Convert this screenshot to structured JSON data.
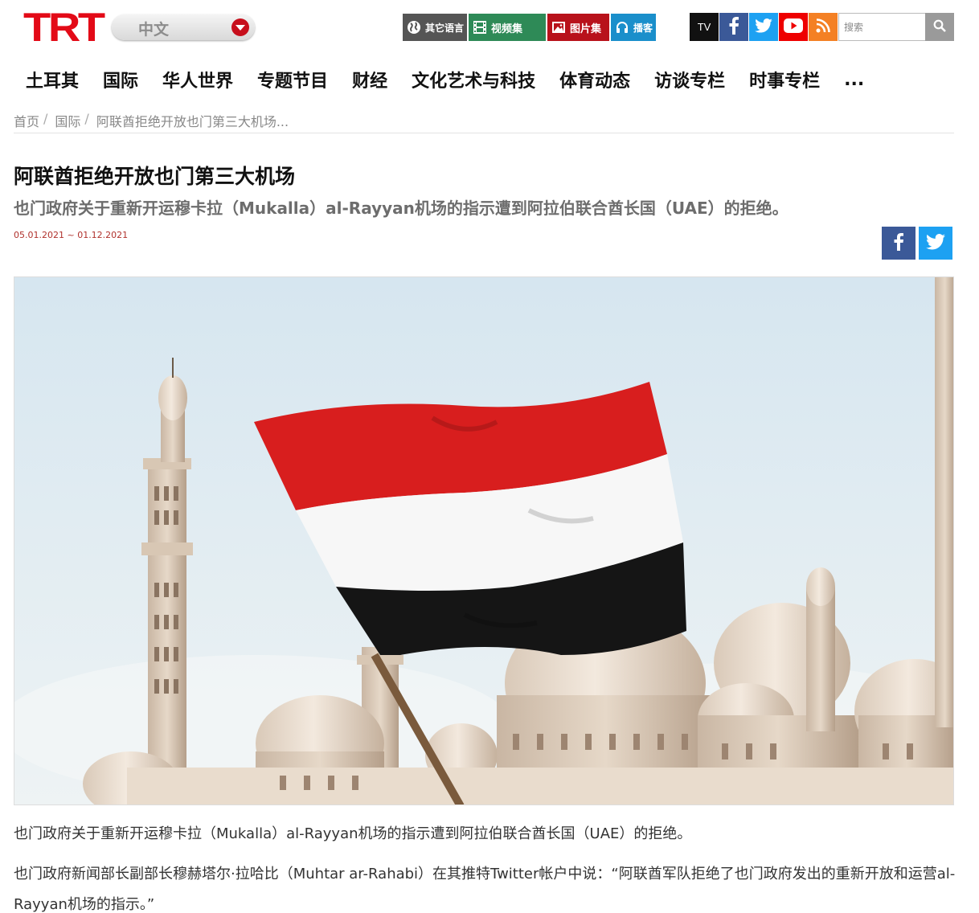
{
  "header": {
    "logo_text": "TRT",
    "language": "中文",
    "section_buttons": {
      "other_languages": "其它语言",
      "video": "视频集",
      "photo": "图片集",
      "podcast": "播客"
    },
    "social": {
      "tv": "TV"
    },
    "search_placeholder": "搜索"
  },
  "nav": {
    "items": [
      "土耳其",
      "国际",
      "华人世界",
      "专题节目",
      "财经",
      "文化艺术与科技",
      "体育动态",
      "访谈专栏",
      "时事专栏",
      "..."
    ]
  },
  "breadcrumb": {
    "items": [
      "首页",
      "国际",
      "阿联酋拒绝开放也门第三大机场..."
    ],
    "separator": "/"
  },
  "article": {
    "title": "阿联酋拒绝开放也门第三大机场",
    "subtitle": "也门政府关于重新开运穆卡拉（Mukalla）al-Rayyan机场的指示遭到阿拉伯联合酋长国（UAE）的拒绝。",
    "date": "05.01.2021 ~ 01.12.2021",
    "paragraphs": [
      "也门政府关于重新开运穆卡拉（Mukalla）al-Rayyan机场的指示遭到阿拉伯联合酋长国（UAE）的拒绝。",
      "也门政府新闻部长副部长穆赫塔尔·拉哈比（Muhtar ar-Rahabi）在其推特Twitter帐户中说：“阿联酋军队拒绝了也门政府发出的重新开放和运营al-Rayyan机场的指示。”"
    ]
  },
  "colors": {
    "brand_red": "#e30a17",
    "video_green": "#2e8a57",
    "photo_red": "#b8121b",
    "podcast_blue": "#1da1f2",
    "facebook": "#3b5998",
    "twitter": "#1da1f2",
    "youtube": "#ee0000",
    "rss": "#f48024",
    "date_red": "#b0312c"
  },
  "icons": {
    "other_languages": "globe-icon",
    "video": "film-icon",
    "photo": "image-icon",
    "podcast": "headphones-icon",
    "facebook": "facebook-icon",
    "twitter": "twitter-icon",
    "youtube": "youtube-icon",
    "rss": "rss-icon",
    "search": "search-icon"
  }
}
